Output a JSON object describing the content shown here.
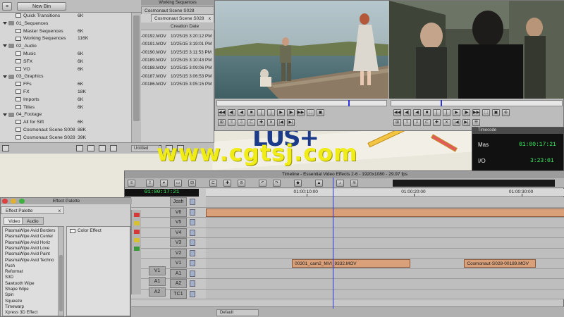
{
  "bin": {
    "new_bin_label": "New Bin",
    "rows": [
      {
        "name": "Quick Transitions",
        "size": "6K",
        "kind": "seq",
        "indent": 1
      },
      {
        "name": "01_Sequences",
        "size": "",
        "kind": "folder",
        "indent": 0
      },
      {
        "name": "Master Sequences",
        "size": "6K",
        "kind": "seq",
        "indent": 1
      },
      {
        "name": "Working Sequences",
        "size": "116K",
        "kind": "seq",
        "indent": 1
      },
      {
        "name": "02_Audio",
        "size": "",
        "kind": "folder",
        "indent": 0
      },
      {
        "name": "Music",
        "size": "6K",
        "kind": "seq",
        "indent": 1
      },
      {
        "name": "SFX",
        "size": "6K",
        "kind": "seq",
        "indent": 1
      },
      {
        "name": "VO",
        "size": "6K",
        "kind": "seq",
        "indent": 1
      },
      {
        "name": "03_Graphics",
        "size": "",
        "kind": "folder",
        "indent": 0
      },
      {
        "name": "FFs",
        "size": "6K",
        "kind": "seq",
        "indent": 1
      },
      {
        "name": "FX",
        "size": "18K",
        "kind": "seq",
        "indent": 1
      },
      {
        "name": "Imports",
        "size": "6K",
        "kind": "seq",
        "indent": 1
      },
      {
        "name": "Titles",
        "size": "6K",
        "kind": "seq",
        "indent": 1
      },
      {
        "name": "04_Footage",
        "size": "",
        "kind": "folder",
        "indent": 0
      },
      {
        "name": "All for Sift",
        "size": "6K",
        "kind": "seq",
        "indent": 1
      },
      {
        "name": "Cosmonaut Scene S008",
        "size": "88K",
        "kind": "seq",
        "indent": 1
      },
      {
        "name": "Cosmonaut Scene S028",
        "size": "39K",
        "kind": "seq",
        "indent": 1
      }
    ],
    "bottom_select": "Untitled"
  },
  "bin2": {
    "title": "Working Sequences",
    "tab1": "Cosmonaut Scene S028",
    "tab2": "Cosmonaut Scene S028",
    "close": "x",
    "header_date": "Creation Date",
    "rows": [
      {
        "name": "-00192.MOV",
        "date": "10/25/15 3:20:12 PM"
      },
      {
        "name": "-00191.MOV",
        "date": "10/25/15 3:19:01 PM"
      },
      {
        "name": "-00190.MOV",
        "date": "10/25/15 3:11:53 PM"
      },
      {
        "name": "-00189.MOV",
        "date": "10/25/15 3:10:43 PM"
      },
      {
        "name": "-00188.MOV",
        "date": "10/25/15 3:09:06 PM"
      },
      {
        "name": "-00187.MOV",
        "date": "10/25/15 3:06:53 PM"
      },
      {
        "name": "-00186.MOV",
        "date": "10/25/15 3:05:15 PM"
      }
    ]
  },
  "timecode_window": {
    "title": "Timecode",
    "mas_label": "Mas",
    "mas_value": "01:00:17:21",
    "io_label": "I/O",
    "io_value": "3:23:01"
  },
  "timeline": {
    "title": "Timeline - Essential Video Effects 2-6 - 1920x1080 - 29.97 fps",
    "current_tc": "01:00:17:21",
    "ruler_marks": [
      "01:00:10:00",
      "01:00:20:00",
      "01:00:30:00"
    ],
    "playhead_fraction": 0.5,
    "tracks": [
      {
        "label": "Josh",
        "clips": []
      },
      {
        "label": "V6",
        "clips": [
          {
            "name": "",
            "start": 0.0,
            "end": 1.0
          }
        ]
      },
      {
        "label": "V5",
        "clips": []
      },
      {
        "label": "V4",
        "clips": []
      },
      {
        "label": "V3",
        "clips": []
      },
      {
        "label": "V2",
        "clips": []
      },
      {
        "label": "V1",
        "clips": [
          {
            "name": "00301_cam2_MVI_9332.MOV",
            "start": 0.24,
            "end": 0.57
          },
          {
            "name": "Cosmonaut-S028-00189.MOV",
            "start": 0.72,
            "end": 0.92
          }
        ]
      },
      {
        "label": "A1",
        "clips": []
      },
      {
        "label": "A2",
        "clips": []
      },
      {
        "label": "TC1",
        "clips": []
      }
    ],
    "src_v1": "V1",
    "src_a1": "A1",
    "src_a2": "A2",
    "bottom_select": "Default"
  },
  "effect_palette": {
    "window_title": "Effect Palette",
    "sub_title": "Effect Palette",
    "close": "x",
    "tab_video": "Video",
    "tab_audio": "Audio",
    "items": [
      "PlasmaWipe Avid Borders",
      "PlasmaWipe Avid Center",
      "PlasmaWipe Avid Horiz",
      "PlasmaWipe Avid Love",
      "PlasmaWipe Avid Paint",
      "PlasmaWipe Avid Techno",
      "Push",
      "Reformat",
      "S3D",
      "Sawtooth Wipe",
      "Shape Wipe",
      "Spin",
      "Squeeze",
      "Timewarp",
      "Xpress 3D Effect"
    ],
    "right_item": "Color Effect"
  },
  "watermark": "www.cgtsj.com",
  "colors": {
    "clip_fill": "#d9a07a",
    "playhead": "#2a32e0",
    "tc_green": "#3cf060",
    "watermark": "#f0ec18"
  }
}
